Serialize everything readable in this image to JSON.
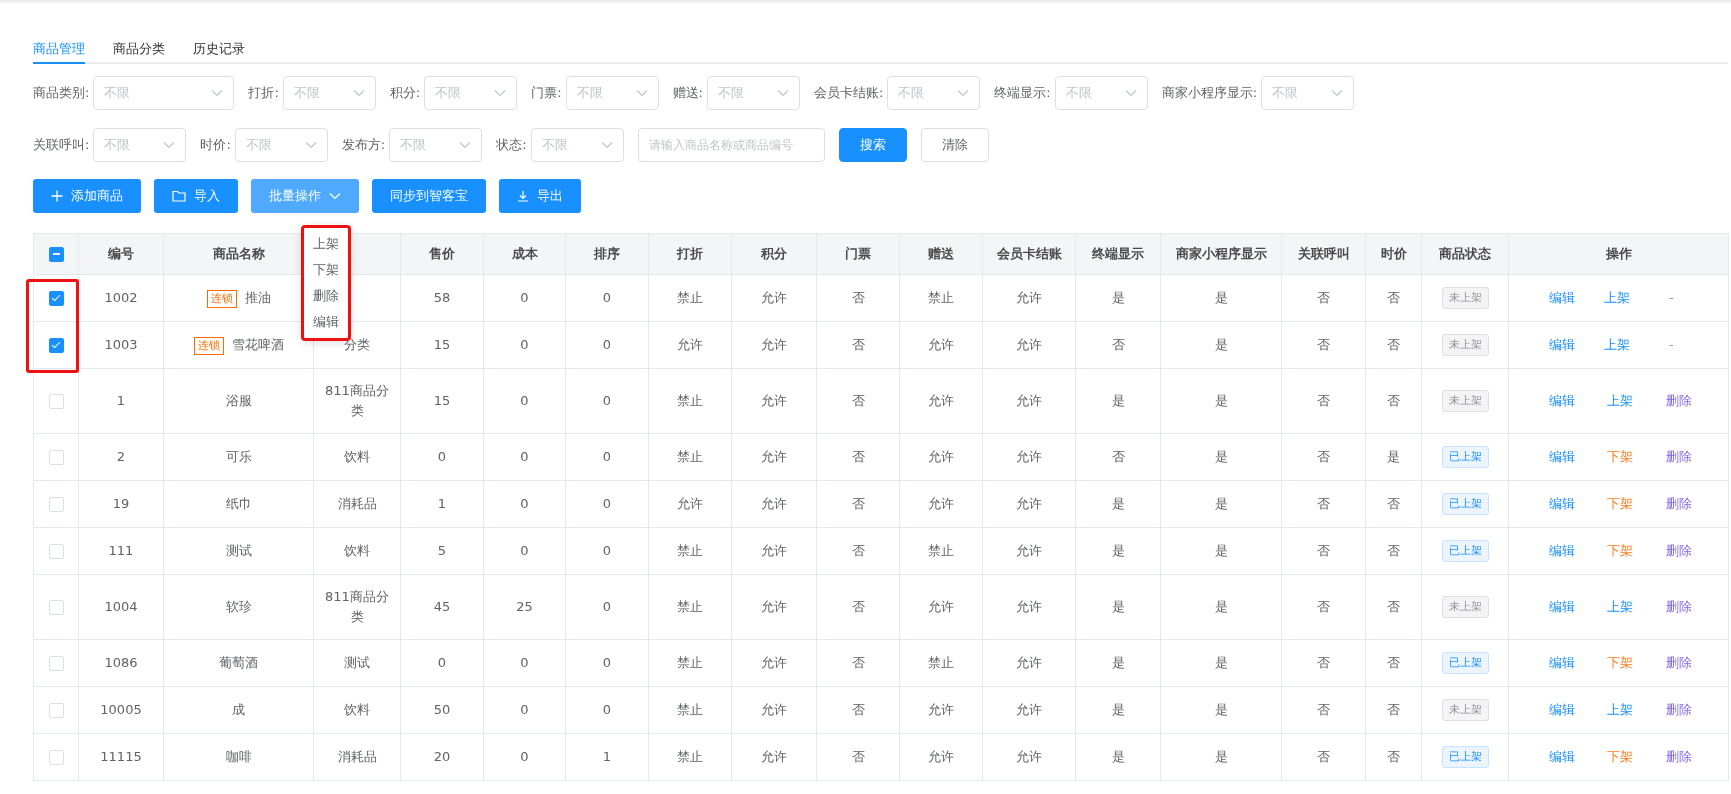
{
  "tabs": [
    {
      "label": "商品管理",
      "selected": true
    },
    {
      "label": "商品分类",
      "selected": false
    },
    {
      "label": "历史记录",
      "selected": false
    }
  ],
  "filters": [
    {
      "kind": "select",
      "label": "商品类别:",
      "value": "不限"
    },
    {
      "kind": "select",
      "label": "打折:",
      "value": "不限"
    },
    {
      "kind": "select",
      "label": "积分:",
      "value": "不限"
    },
    {
      "kind": "select",
      "label": "门票:",
      "value": "不限"
    },
    {
      "kind": "select",
      "label": "赠送:",
      "value": "不限"
    },
    {
      "kind": "select",
      "label": "会员卡结账:",
      "value": "不限"
    },
    {
      "kind": "select",
      "label": "终端显示:",
      "value": "不限"
    },
    {
      "kind": "select",
      "label": "商家小程序显示:",
      "value": "不限"
    },
    {
      "kind": "break"
    },
    {
      "kind": "select",
      "label": "关联呼叫:",
      "value": "不限"
    },
    {
      "kind": "select",
      "label": "时价:",
      "value": "不限"
    },
    {
      "kind": "select",
      "label": "发布方:",
      "value": "不限"
    },
    {
      "kind": "select",
      "label": "状态:",
      "value": "不限"
    },
    {
      "kind": "search",
      "placeholder": "请输入商品名称或商品编号"
    },
    {
      "kind": "primary",
      "label": "搜索"
    },
    {
      "kind": "plain",
      "label": "清除"
    }
  ],
  "toolbar": [
    {
      "kind": "add",
      "label": "添加商品",
      "active": false
    },
    {
      "kind": "import",
      "label": "导入",
      "active": false
    },
    {
      "kind": "batch",
      "label": "批量操作",
      "active": true
    },
    {
      "kind": "sync",
      "label": "同步到智客宝",
      "active": false
    },
    {
      "kind": "export",
      "label": "导出",
      "active": false
    }
  ],
  "batch_menu": {
    "items": [
      "上架",
      "下架",
      "删除",
      "编辑"
    ],
    "highlighted": true
  },
  "table": {
    "header_indeterminate": true,
    "selection_outline": true,
    "columns": [
      {
        "label": "编号"
      },
      {
        "label": "商品名称"
      },
      {},
      {
        "label": "售价"
      },
      {
        "label": "成本"
      },
      {
        "label": "排序"
      },
      {
        "label": "打折"
      },
      {
        "label": "积分"
      },
      {
        "label": "门票"
      },
      {
        "label": "赠送"
      },
      {
        "label": "会员卡结账"
      },
      {
        "label": "终端显示"
      },
      {
        "label": "商家小程序显示"
      },
      {
        "label": "关联呼叫"
      },
      {
        "label": "时价"
      },
      {
        "label": "商品状态"
      },
      {
        "label": "操作"
      }
    ],
    "rows": [
      {
        "checked": true,
        "cells": [
          "1002",
          {
            "kind": "name",
            "tag": "连锁",
            "text": "推油"
          },
          "",
          "58",
          "0",
          "0",
          "禁止",
          "允许",
          "否",
          "禁止",
          "允许",
          "是",
          "是",
          "否",
          "否",
          {
            "kind": "status",
            "listed": false,
            "text": "未上架"
          },
          {
            "kind": "actions",
            "items": [
              {
                "kind": "edit",
                "label": "编辑"
              },
              {
                "kind": "up",
                "label": "上架"
              },
              {
                "kind": "none",
                "label": "-"
              }
            ]
          }
        ]
      },
      {
        "checked": true,
        "cells": [
          "1003",
          {
            "kind": "name",
            "tag": "连锁",
            "text": "雪花啤酒"
          },
          {
            "kind": "partial",
            "text": "分类"
          },
          "15",
          "0",
          "0",
          "允许",
          "允许",
          "否",
          "允许",
          "允许",
          "否",
          "是",
          "否",
          "否",
          {
            "kind": "status",
            "listed": false,
            "text": "未上架"
          },
          {
            "kind": "actions",
            "items": [
              {
                "kind": "edit",
                "label": "编辑"
              },
              {
                "kind": "up",
                "label": "上架"
              },
              {
                "kind": "none",
                "label": "-"
              }
            ]
          }
        ]
      },
      {
        "checked": false,
        "cells": [
          "1",
          {
            "kind": "name",
            "text": "浴服"
          },
          "811商品分类",
          "15",
          "0",
          "0",
          "禁止",
          "允许",
          "否",
          "允许",
          "允许",
          "是",
          "是",
          "否",
          "否",
          {
            "kind": "status",
            "listed": false,
            "text": "未上架"
          },
          {
            "kind": "actions",
            "items": [
              {
                "kind": "edit",
                "label": "编辑"
              },
              {
                "kind": "up",
                "label": "上架"
              },
              {
                "kind": "delete",
                "label": "删除"
              }
            ]
          }
        ]
      },
      {
        "checked": false,
        "cells": [
          "2",
          {
            "kind": "name",
            "text": "可乐"
          },
          "饮料",
          "0",
          "0",
          "0",
          "禁止",
          "允许",
          "否",
          "允许",
          "允许",
          "否",
          "是",
          "否",
          "是",
          {
            "kind": "status",
            "listed": true,
            "text": "已上架"
          },
          {
            "kind": "actions",
            "items": [
              {
                "kind": "edit",
                "label": "编辑"
              },
              {
                "kind": "down",
                "label": "下架"
              },
              {
                "kind": "delete",
                "label": "删除"
              }
            ]
          }
        ]
      },
      {
        "checked": false,
        "cells": [
          "19",
          {
            "kind": "name",
            "text": "纸巾"
          },
          "消耗品",
          "1",
          "0",
          "0",
          "允许",
          "允许",
          "否",
          "允许",
          "允许",
          "是",
          "是",
          "否",
          "否",
          {
            "kind": "status",
            "listed": true,
            "text": "已上架"
          },
          {
            "kind": "actions",
            "items": [
              {
                "kind": "edit",
                "label": "编辑"
              },
              {
                "kind": "down",
                "label": "下架"
              },
              {
                "kind": "delete",
                "label": "删除"
              }
            ]
          }
        ]
      },
      {
        "checked": false,
        "cells": [
          "111",
          {
            "kind": "name",
            "text": "测试"
          },
          "饮料",
          "5",
          "0",
          "0",
          "禁止",
          "允许",
          "否",
          "禁止",
          "允许",
          "是",
          "是",
          "否",
          "否",
          {
            "kind": "status",
            "listed": true,
            "text": "已上架"
          },
          {
            "kind": "actions",
            "items": [
              {
                "kind": "edit",
                "label": "编辑"
              },
              {
                "kind": "down",
                "label": "下架"
              },
              {
                "kind": "delete",
                "label": "删除"
              }
            ]
          }
        ]
      },
      {
        "checked": false,
        "cells": [
          "1004",
          {
            "kind": "name",
            "text": "软珍"
          },
          "811商品分类",
          "45",
          "25",
          "0",
          "禁止",
          "允许",
          "否",
          "允许",
          "允许",
          "是",
          "是",
          "否",
          "否",
          {
            "kind": "status",
            "listed": false,
            "text": "未上架"
          },
          {
            "kind": "actions",
            "items": [
              {
                "kind": "edit",
                "label": "编辑"
              },
              {
                "kind": "up",
                "label": "上架"
              },
              {
                "kind": "delete",
                "label": "删除"
              }
            ]
          }
        ]
      },
      {
        "checked": false,
        "cells": [
          "1086",
          {
            "kind": "name",
            "text": "葡萄酒"
          },
          "测试",
          "0",
          "0",
          "0",
          "禁止",
          "允许",
          "否",
          "禁止",
          "允许",
          "是",
          "是",
          "否",
          "否",
          {
            "kind": "status",
            "listed": true,
            "text": "已上架"
          },
          {
            "kind": "actions",
            "items": [
              {
                "kind": "edit",
                "label": "编辑"
              },
              {
                "kind": "down",
                "label": "下架"
              },
              {
                "kind": "delete",
                "label": "删除"
              }
            ]
          }
        ]
      },
      {
        "checked": false,
        "cells": [
          "10005",
          {
            "kind": "name",
            "text": "成"
          },
          "饮料",
          "50",
          "0",
          "0",
          "禁止",
          "允许",
          "否",
          "允许",
          "允许",
          "是",
          "是",
          "否",
          "否",
          {
            "kind": "status",
            "listed": false,
            "text": "未上架"
          },
          {
            "kind": "actions",
            "items": [
              {
                "kind": "edit",
                "label": "编辑"
              },
              {
                "kind": "up",
                "label": "上架"
              },
              {
                "kind": "delete",
                "label": "删除"
              }
            ]
          }
        ]
      },
      {
        "checked": false,
        "cells": [
          "11115",
          {
            "kind": "name",
            "text": "咖啡"
          },
          "消耗品",
          "20",
          "0",
          "1",
          "禁止",
          "允许",
          "否",
          "允许",
          "允许",
          "是",
          "是",
          "否",
          "否",
          {
            "kind": "status",
            "listed": true,
            "text": "已上架"
          },
          {
            "kind": "actions",
            "items": [
              {
                "kind": "edit",
                "label": "编辑"
              },
              {
                "kind": "down",
                "label": "下架"
              },
              {
                "kind": "delete",
                "label": "删除"
              }
            ]
          }
        ]
      }
    ]
  }
}
